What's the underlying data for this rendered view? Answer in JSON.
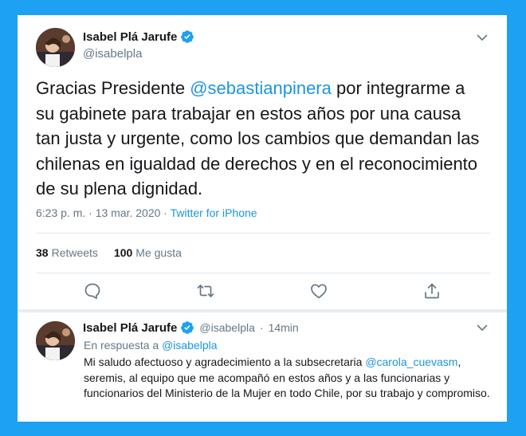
{
  "tweet": {
    "author_name": "Isabel Plá Jarufe",
    "author_handle": "@isabelpla",
    "text_before": "Gracias Presidente ",
    "mention": "@sebastianpinera",
    "text_after": " por integrarme a su gabinete para trabajar en estos años por una causa tan justa y urgente, como los cambios que demandan las chilenas en igualdad de derechos y en el reconocimiento de su plena dignidad.",
    "timestamp": "6:23 p. m. · 13 mar. 2020 · ",
    "source": "Twitter for iPhone",
    "retweets_count": "38",
    "retweets_label": "Retweets",
    "likes_count": "100",
    "likes_label": "Me gusta"
  },
  "reply": {
    "author_name": "Isabel Plá Jarufe",
    "author_handle": "@isabelpla",
    "separator": "·",
    "time": "14min",
    "replying_label": "En respuesta a ",
    "replying_handle": "@isabelpla",
    "text_before": "Mi saludo afectuoso y agradecimiento a la subsecretaria ",
    "mention": "@carola_cuevasm",
    "text_after": ", seremis, al equipo que me acompañó en estos años y a las funcionarias y funcionarios del Ministerio de la Mujer en todo Chile, por su trabajo y compromiso."
  },
  "icons": {
    "verified": "verified-badge-icon",
    "more": "chevron-down-icon",
    "reply": "reply-icon",
    "retweet": "retweet-icon",
    "like": "heart-icon",
    "share": "share-icon"
  },
  "colors": {
    "background": "#1da1f2",
    "link": "#1b95e0",
    "secondary_text": "#657786",
    "primary_text": "#14171a"
  }
}
